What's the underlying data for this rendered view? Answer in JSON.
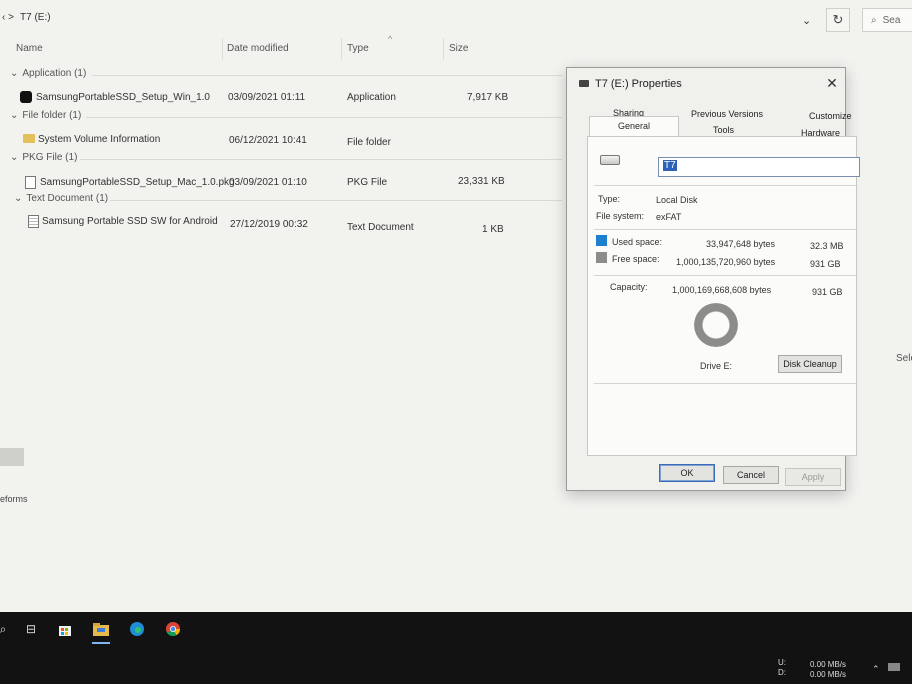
{
  "explorer": {
    "path": "T7 (E:)",
    "search_placeholder": "Sea",
    "columns": {
      "name": "Name",
      "date": "Date modified",
      "type": "Type",
      "size": "Size"
    },
    "groups": [
      {
        "label": "Application (1)",
        "rows": [
          {
            "name": "SamsungPortableSSD_Setup_Win_1.0",
            "date": "03/09/2021 01:11",
            "type": "Application",
            "size": "7,917 KB",
            "icon": "samsung-app-icon"
          }
        ]
      },
      {
        "label": "File folder (1)",
        "rows": [
          {
            "name": "System Volume Information",
            "date": "06/12/2021 10:41",
            "type": "File folder",
            "size": "",
            "icon": "folder-icon"
          }
        ]
      },
      {
        "label": "PKG File (1)",
        "rows": [
          {
            "name": "SamsungPortableSSD_Setup_Mac_1.0.pkg",
            "date": "03/09/2021 01:10",
            "type": "PKG File",
            "size": "23,331 KB",
            "icon": "file-icon"
          }
        ]
      },
      {
        "label": "Text Document (1)",
        "rows": [
          {
            "name": "Samsung Portable SSD SW for Android",
            "date": "27/12/2019 00:32",
            "type": "Text Document",
            "size": "1 KB",
            "icon": "text-document-icon"
          }
        ]
      }
    ],
    "left_label": "eforms",
    "right_label": "Sele"
  },
  "dialog": {
    "title": "T7 (E:) Properties",
    "tabs_row1": [
      "Sharing",
      "Previous Versions",
      "Customize"
    ],
    "tabs_row2": [
      "General",
      "Tools",
      "Hardware"
    ],
    "active_tab": "General",
    "volume_name": "T7",
    "type_label": "Type:",
    "type_value": "Local Disk",
    "fs_label": "File system:",
    "fs_value": "exFAT",
    "used_label": "Used space:",
    "used_bytes": "33,947,648 bytes",
    "used_short": "32.3 MB",
    "free_label": "Free space:",
    "free_bytes": "1,000,135,720,960 bytes",
    "free_short": "931 GB",
    "capacity_label": "Capacity:",
    "capacity_bytes": "1,000,169,668,608 bytes",
    "capacity_short": "931 GB",
    "used_fraction": 3.4e-05,
    "drive_label": "Drive E:",
    "disk_cleanup": "Disk Cleanup",
    "ok": "OK",
    "cancel": "Cancel",
    "apply": "Apply",
    "colors": {
      "used": "#1e7fd0",
      "free": "#8c8c8a"
    }
  },
  "tray": {
    "drive_u": "U:",
    "drive_d": "D:",
    "rate1": "0.00 MB/s",
    "rate2": "0.00 MB/s"
  }
}
